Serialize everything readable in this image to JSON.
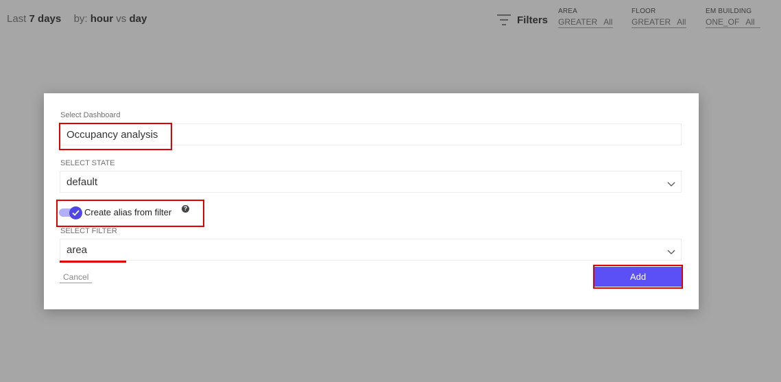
{
  "header": {
    "range_prefix": "Last",
    "range_value": "7 days",
    "by_label": "by:",
    "group_primary": "hour",
    "vs_label": "vs",
    "group_compare": "day"
  },
  "filters": {
    "label": "Filters",
    "icon": "filter-icon",
    "items": [
      {
        "name": "AREA",
        "operator": "GREATER",
        "value": "All"
      },
      {
        "name": "FLOOR",
        "operator": "GREATER",
        "value": "All"
      },
      {
        "name": "EM BUILDING",
        "operator": "ONE_OF",
        "value": "All"
      }
    ]
  },
  "dialog": {
    "dashboard_label": "Select Dashboard",
    "dashboard_value": "Occupancy analysis",
    "state_label": "SELECT STATE",
    "state_value": "default",
    "alias_toggle_label": "Create alias from filter",
    "alias_toggle_on": true,
    "help_symbol": "?",
    "filter_label": "SELECT FILTER",
    "filter_value": "area",
    "cancel_label": "Cancel",
    "add_label": "Add"
  },
  "colors": {
    "accent": "#5b50f5",
    "highlight": "#e00000",
    "overlay": "#a6a6a6"
  }
}
